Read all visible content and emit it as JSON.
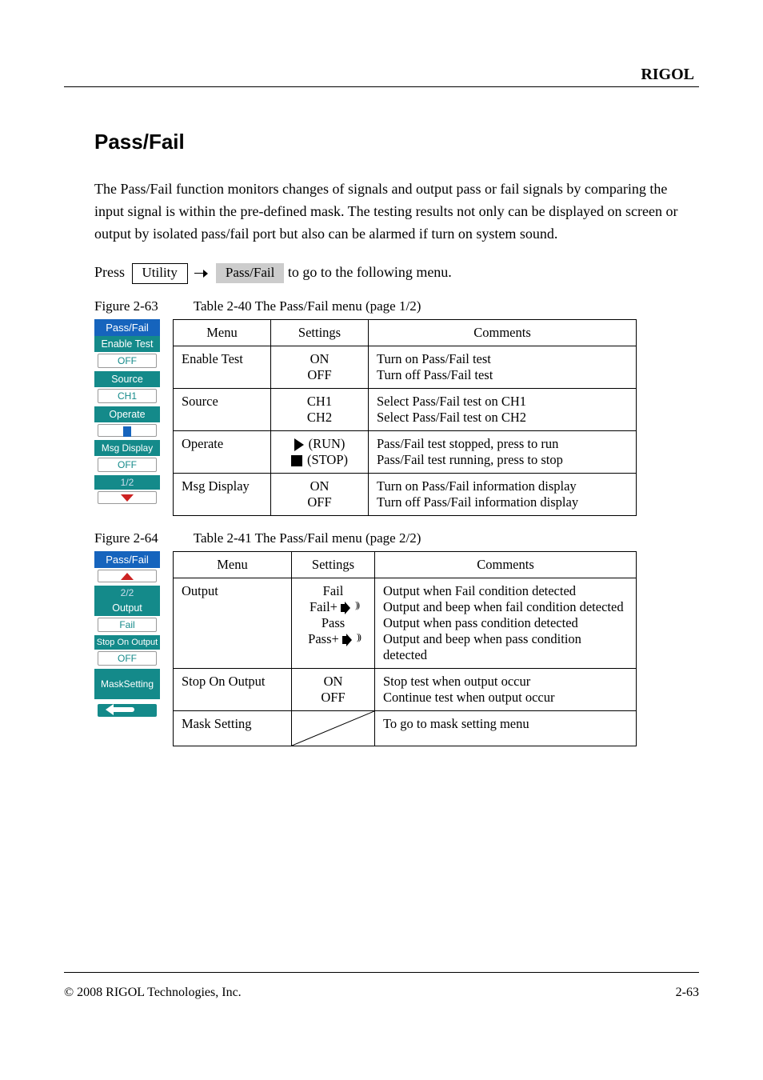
{
  "brand": "RIGOL",
  "footer_left": "© 2008 RIGOL Technologies, Inc.",
  "footer_right": "2-63",
  "heading": "Pass/Fail",
  "paragraph": "The Pass/Fail function monitors changes of signals and output pass or fail signals by comparing the input signal is within the pre-defined mask. The testing results not only can be displayed on screen or output by isolated pass/fail port but also can be alarmed if turn on system sound.",
  "press": {
    "lead": "Press",
    "key": "Utility",
    "soft": "Pass/Fail",
    "tail": "to go to the following menu."
  },
  "fig1": {
    "num": "Figure 2-63",
    "tbl": "Table 2-40 The Pass/Fail menu (page 1/2)"
  },
  "fig2": {
    "num": "Figure 2-64",
    "tbl": "Table 2-41 The Pass/Fail menu (page 2/2)"
  },
  "thead": {
    "menu": "Menu",
    "settings": "Settings",
    "comments": "Comments"
  },
  "t1": {
    "r1": {
      "m": "Enable Test",
      "s1": "ON",
      "s2": "OFF",
      "c1": "Turn on Pass/Fail test",
      "c2": "Turn off Pass/Fail test"
    },
    "r2": {
      "m": "Source",
      "s1": "CH1",
      "s2": "CH2",
      "c1": "Select Pass/Fail test on CH1",
      "c2": "Select Pass/Fail test on CH2"
    },
    "r3": {
      "m": "Operate",
      "s1": "(RUN)",
      "s2": "(STOP)",
      "c1": "Pass/Fail test stopped, press to run",
      "c2": "Pass/Fail test running, press to stop"
    },
    "r4": {
      "m": "Msg Display",
      "s1": "ON",
      "s2": "OFF",
      "c1": "Turn on Pass/Fail information display",
      "c2": "Turn off Pass/Fail information display"
    }
  },
  "t2": {
    "r1": {
      "m": "Output",
      "s1": "Fail",
      "s2": "Fail+",
      "s3": "Pass",
      "s4": "Pass+",
      "c1": "Output when Fail condition detected",
      "c2": "Output and beep when fail condition detected",
      "c3": "Output when pass condition detected",
      "c4": "Output and beep when pass condition detected"
    },
    "r2": {
      "m": "Stop On Output",
      "s1": "ON",
      "s2": "OFF",
      "c1": "Stop test when output occur",
      "c2": "Continue test when output occur"
    },
    "r3": {
      "m": "Mask Setting",
      "c": "To go to mask setting menu"
    }
  },
  "sidemenu1": {
    "title": "Pass/Fail",
    "enable": "Enable Test",
    "enable_val": "OFF",
    "source": "Source",
    "source_val": "CH1",
    "operate": "Operate",
    "msg": "Msg Display",
    "msg_val": "OFF",
    "page": "1/2"
  },
  "sidemenu2": {
    "title": "Pass/Fail",
    "page": "2/2",
    "output": "Output",
    "output_val": "Fail",
    "stop": "Stop On Output",
    "stop_val": "OFF",
    "mask": "MaskSetting"
  }
}
